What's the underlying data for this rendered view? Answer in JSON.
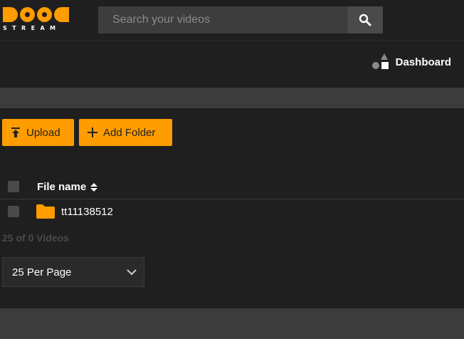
{
  "brand": {
    "logo_text": "STREAM",
    "accent_color": "#ff9c00"
  },
  "search": {
    "placeholder": "Search your videos",
    "icon": "search-icon"
  },
  "nav": {
    "dashboard_label": "Dashboard",
    "dashboard_icon": "shapes-icon"
  },
  "toolbar": {
    "upload_label": "Upload",
    "upload_icon": "upload-icon",
    "add_folder_label": "Add Folder",
    "add_folder_icon": "plus-icon"
  },
  "table": {
    "columns": [
      {
        "label": "File name",
        "sort_icon": "sort-icon"
      }
    ],
    "rows": [
      {
        "type": "folder",
        "icon": "folder-icon",
        "name": "tt11138512",
        "checked": false
      }
    ]
  },
  "footer": {
    "count_text": "25 of 0 Videos",
    "per_page": {
      "selected": "25 Per Page"
    }
  }
}
